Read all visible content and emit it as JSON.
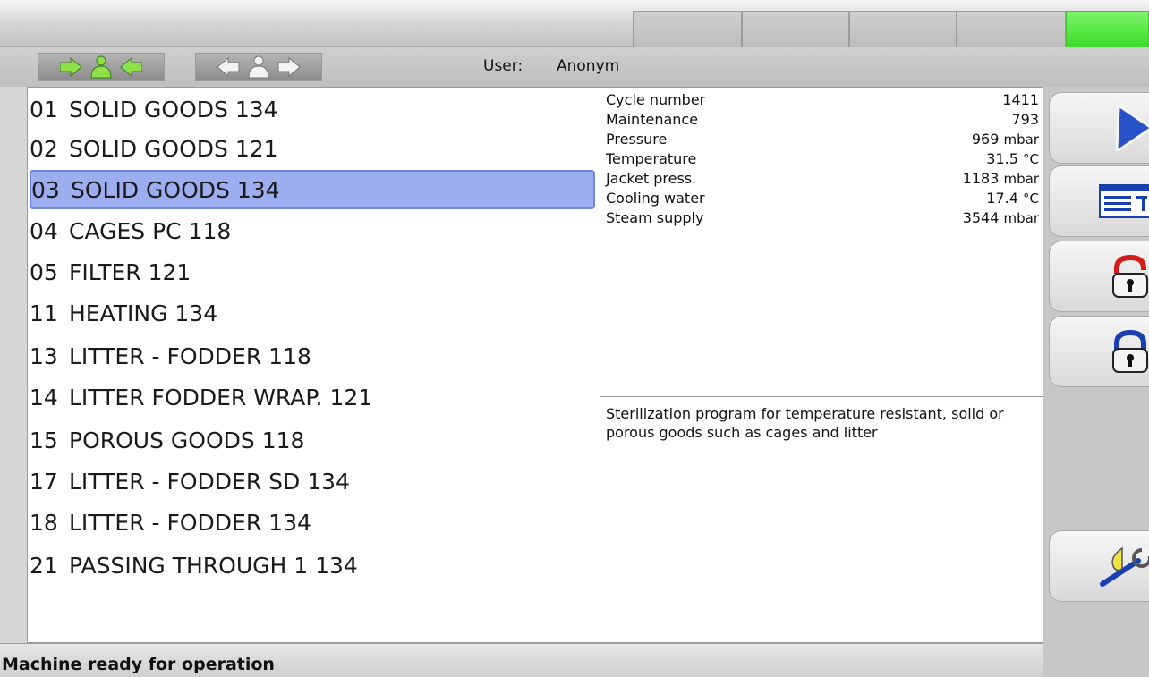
{
  "user": {
    "label": "User:",
    "name": "Anonym"
  },
  "programs": [
    {
      "num": "01",
      "name": "SOLID GOODS 134",
      "selected": false
    },
    {
      "num": "02",
      "name": "SOLID GOODS 121",
      "selected": false
    },
    {
      "num": "03",
      "name": "SOLID GOODS 134",
      "selected": true
    },
    {
      "num": "04",
      "name": "CAGES PC 118",
      "selected": false
    },
    {
      "num": "05",
      "name": "FILTER 121",
      "selected": false
    },
    {
      "num": "11",
      "name": "HEATING 134",
      "selected": false
    },
    {
      "num": "13",
      "name": "LITTER - FODDER 118",
      "selected": false
    },
    {
      "num": "14",
      "name": "LITTER FODDER WRAP. 121",
      "selected": false
    },
    {
      "num": "15",
      "name": "POROUS GOODS 118",
      "selected": false
    },
    {
      "num": "17",
      "name": "LITTER - FODDER SD 134",
      "selected": false
    },
    {
      "num": "18",
      "name": "LITTER - FODDER 134",
      "selected": false
    },
    {
      "num": "21",
      "name": "PASSING THROUGH 1 134",
      "selected": false
    }
  ],
  "details": [
    {
      "label": "Cycle number",
      "value": "1411",
      "unit": ""
    },
    {
      "label": "Maintenance",
      "value": "793",
      "unit": ""
    },
    {
      "label": "Pressure",
      "value": "969",
      "unit": "mbar"
    },
    {
      "label": "Temperature",
      "value": "31.5",
      "unit": "°C"
    },
    {
      "label": "Jacket press.",
      "value": "1183",
      "unit": "mbar"
    },
    {
      "label": "Cooling water",
      "value": "17.4",
      "unit": "°C"
    },
    {
      "label": "Steam supply",
      "value": "3544",
      "unit": "mbar"
    }
  ],
  "description": "Sterilization program for temperature resistant, solid or porous goods such as cages and litter",
  "status": "Machine ready for operation",
  "side_buttons": [
    "play-icon",
    "program-list-icon",
    "unlock-icon",
    "lock-icon",
    "service-wrench-icon"
  ],
  "colors": {
    "selected_row": "#9daef0",
    "active_tab": "#3ddc2a",
    "play_arrow": "#2a52c8"
  }
}
